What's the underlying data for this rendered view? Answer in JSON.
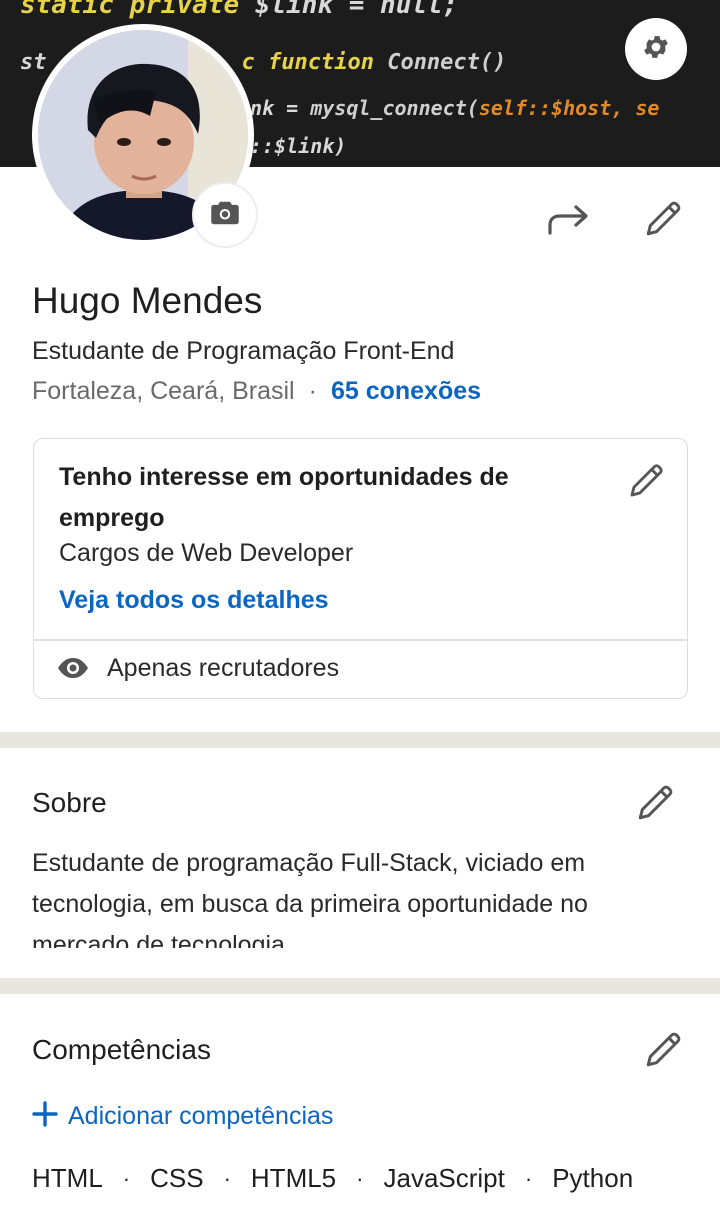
{
  "banner": {
    "code_line_1_kw": "static private",
    "code_line_1_rest": " $link = null;",
    "code_line_2_pre": "st",
    "code_line_2_kw": "c function",
    "code_line_2_fn": " Connect()",
    "code_line_3_pre": "nk = ",
    "code_line_3_fn": "mysql_connect(",
    "code_line_3_str": "self::$host, se",
    "code_line_4": "::$link)"
  },
  "icons": {
    "settings": "gear-icon",
    "camera": "camera-icon",
    "share": "share-arrow-icon",
    "edit": "pencil-icon",
    "visibility": "eye-icon",
    "add": "plus-icon"
  },
  "profile": {
    "name": "Hugo Mendes",
    "headline": "Estudante de Programação Front-End",
    "location": "Fortaleza, Ceará, Brasil",
    "separator": "·",
    "connections": "65 conexões"
  },
  "open_to_work": {
    "title": "Tenho interesse em oportunidades de emprego",
    "roles": "Cargos de Web Developer",
    "details_link": "Veja todos os detalhes",
    "visibility": "Apenas recrutadores"
  },
  "about": {
    "title": "Sobre",
    "text": "Estudante de programação Full-Stack, viciado em tecnologia, em busca da primeira oportunidade no mercado de tecnologia."
  },
  "skills": {
    "title": "Competências",
    "add_label": "Adicionar competências",
    "items": [
      "HTML",
      "CSS",
      "HTML5",
      "JavaScript",
      "Python"
    ],
    "separator": "·"
  },
  "colors": {
    "accent": "#0a66c2",
    "banner_bg": "#1c1c1c",
    "section_gap": "#e9e6df",
    "text": "#1f1f1f",
    "muted": "#6a6a6a"
  }
}
